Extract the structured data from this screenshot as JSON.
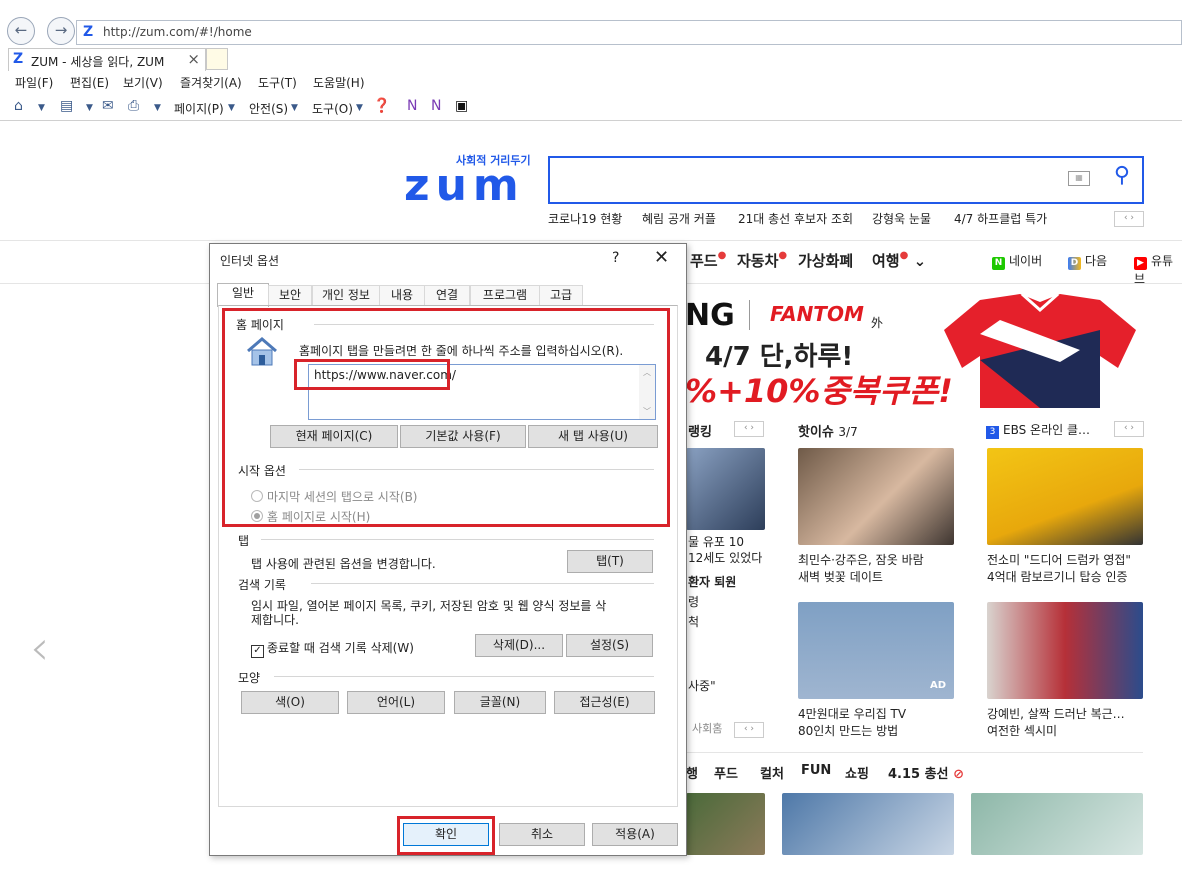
{
  "browser": {
    "url": "http://zum.com/#!/home",
    "tab_title": "ZUM - 세상을 읽다, ZUM",
    "menu": [
      "파일(F)",
      "편집(E)",
      "보기(V)",
      "즐겨찾기(A)",
      "도구(T)",
      "도움말(H)"
    ],
    "cmd": {
      "page": "페이지(P)",
      "safety": "안전(S)",
      "tools": "도구(O)"
    }
  },
  "zum": {
    "logo_text": "zum",
    "logo_sub": "사회적 거리두기",
    "trends": [
      "코로나19 현황",
      "혜림 공개 커플",
      "21대 총선 후보자 조회",
      "강형욱 눈물",
      "4/7 하프클럽 특가"
    ],
    "gnb": [
      "푸드",
      "자동차",
      "가상화폐",
      "여행"
    ],
    "ext_links": [
      "네이버",
      "다음",
      "유튜브"
    ],
    "banner": {
      "brand": "NG",
      "fantom": "FANTOM",
      "oi": "外",
      "line1": "4/7 단,하루!",
      "line2": "%+10%중복쿠폰!"
    },
    "sections": {
      "ranking": "랭킹",
      "hot": "핫이슈",
      "hot_count": "3/7",
      "ebs": "EBS 온라인 클…"
    },
    "left_captions": [
      "물 유포 10",
      "12세도 있었다",
      "환자 퇴원",
      "령",
      "척",
      "사중\""
    ],
    "left_footer": "사회홈",
    "hot_captions": [
      [
        "최민수·강주은, 잠옷 바람",
        "새벽 벚꽃 데이트"
      ],
      [
        "전소미 \"드디어 드럼카 영접\"",
        "4억대 람보르기니 탑승 인증"
      ],
      [
        "4만원대로 우리집 TV",
        "80인치 만드는 방법"
      ],
      [
        "강예빈, 살짝 드러난 복근…",
        "여전한 섹시미"
      ]
    ],
    "ad_badge": "AD",
    "categories": [
      "행",
      "푸드",
      "컬처",
      "FUN",
      "쇼핑",
      "4.15 총선"
    ]
  },
  "dialog": {
    "title": "인터넷 옵션",
    "help": "?",
    "tabs": [
      "일반",
      "보안",
      "개인 정보",
      "내용",
      "연결",
      "프로그램",
      "고급"
    ],
    "home": {
      "group": "홈 페이지",
      "desc": "홈페이지 탭을 만들려면 한 줄에 하나씩 주소를 입력하십시오(R).",
      "value": "https://www.naver.com/",
      "btn_current": "현재 페이지(C)",
      "btn_default": "기본값 사용(F)",
      "btn_newtab": "새 탭 사용(U)"
    },
    "startup": {
      "group": "시작 옵션",
      "opt1": "마지막 세션의 탭으로 시작(B)",
      "opt2": "홈 페이지로 시작(H)"
    },
    "tabs_group": {
      "group": "탭",
      "desc": "탭 사용에 관련된 옵션을 변경합니다.",
      "btn": "탭(T)"
    },
    "history": {
      "group": "검색 기록",
      "desc1": "임시 파일, 열어본 페이지 목록, 쿠키, 저장된 암호 및 웹 양식 정보를 삭",
      "desc2": "제합니다.",
      "chk": "종료할 때 검색 기록 삭제(W)",
      "btn_delete": "삭제(D)...",
      "btn_settings": "설정(S)"
    },
    "appearance": {
      "group": "모양",
      "btn_color": "색(O)",
      "btn_lang": "언어(L)",
      "btn_font": "글꼴(N)",
      "btn_access": "접근성(E)"
    },
    "footer": {
      "ok": "확인",
      "cancel": "취소",
      "apply": "적용(A)"
    }
  },
  "colors": {
    "zum_blue": "#2159e8",
    "highlight_red": "#d8232a"
  }
}
